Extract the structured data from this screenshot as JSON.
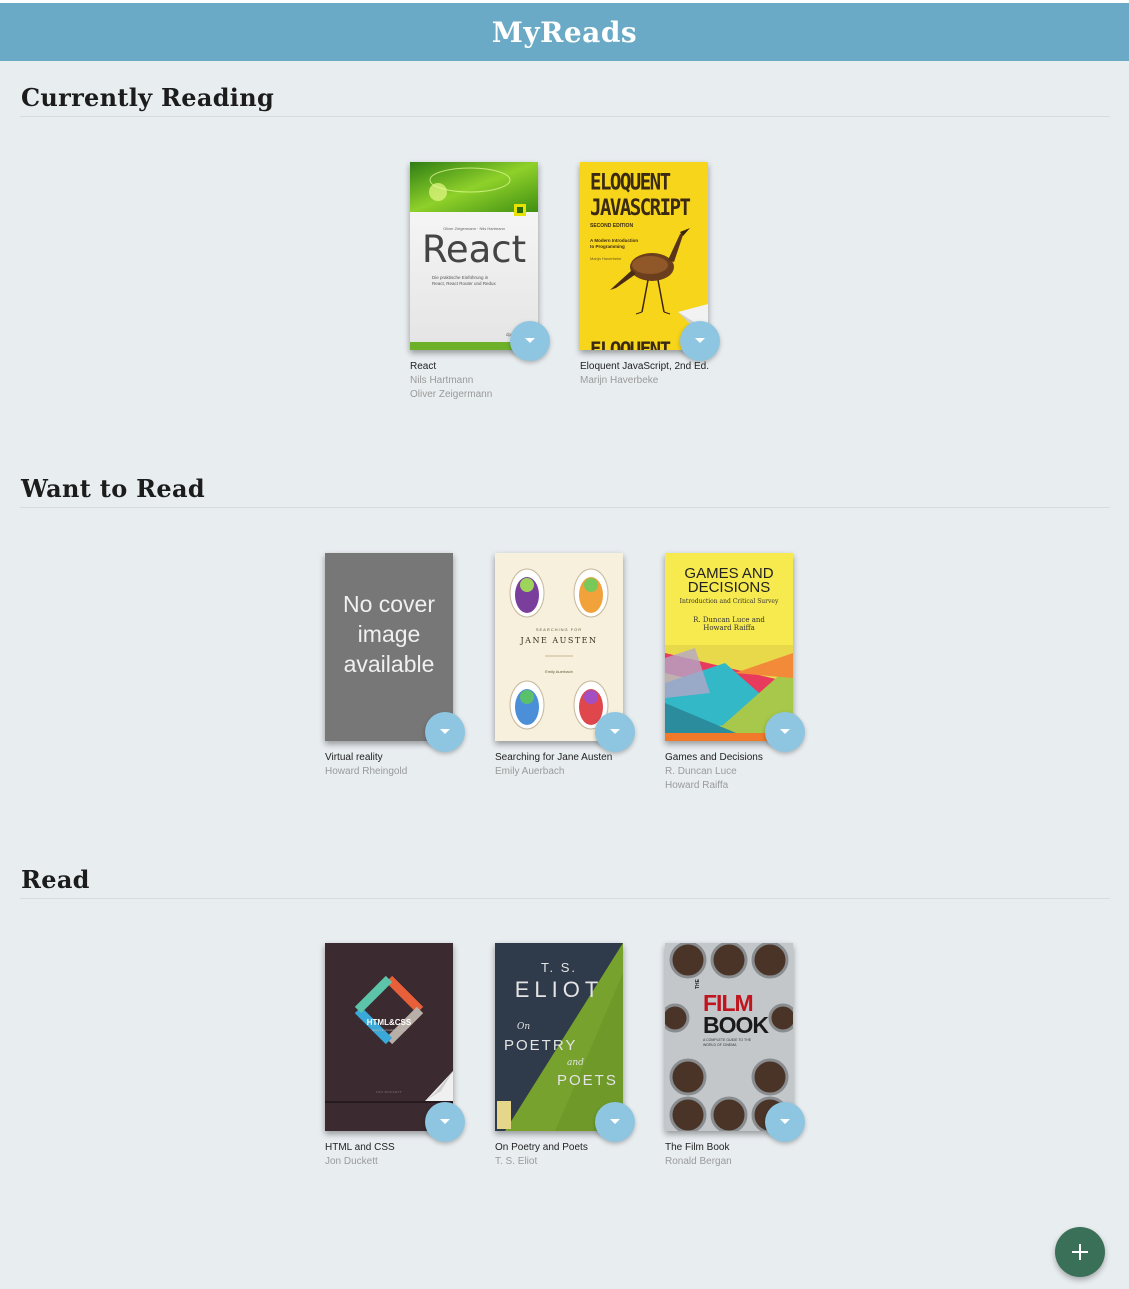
{
  "app": {
    "title": "MyReads"
  },
  "shelves": [
    {
      "title": "Currently Reading",
      "books": [
        {
          "title": "React",
          "authors": [
            "Nils Hartmann",
            "Oliver Zeigermann"
          ],
          "cover": {
            "authors_line": "Oliver Zeigermann · Nils Hartmann",
            "big": "React",
            "sub1": "Die praktische Einführung in",
            "sub2": "React, React Router und Redux",
            "badge": "dpunkt"
          }
        },
        {
          "title": "Eloquent JavaScript, 2nd Ed.",
          "authors": [
            "Marijn Haverbeke"
          ],
          "cover": {
            "line1": "ELOQUENT",
            "line2": "JAVASCRIPT",
            "edition": "SECOND EDITION",
            "sub1": "A Modern Introduction",
            "sub2": "to Programming",
            "author": "Marijn Haverbeke",
            "bottom": "ELOQUENT"
          }
        }
      ]
    },
    {
      "title": "Want to Read",
      "books": [
        {
          "title": "Virtual reality",
          "authors": [
            "Howard Rheingold"
          ],
          "cover": {
            "line1": "No cover",
            "line2": "image",
            "line3": "available"
          }
        },
        {
          "title": "Searching for Jane Austen",
          "authors": [
            "Emily Auerbach"
          ],
          "cover": {
            "small": "SEARCHING FOR",
            "name": "JANE AUSTEN",
            "author": "Emily Auerbach"
          }
        },
        {
          "title": "Games and Decisions",
          "authors": [
            "R. Duncan Luce",
            "Howard Raiffa"
          ],
          "cover": {
            "line1": "GAMES AND",
            "line2": "DECISIONS",
            "sub": "Introduction and Critical Survey",
            "auth1": "R. Duncan Luce and",
            "auth2": "Howard Raiffa"
          }
        }
      ]
    },
    {
      "title": "Read",
      "books": [
        {
          "title": "HTML and CSS",
          "authors": [
            "Jon Duckett"
          ],
          "cover": {
            "logo": "HTML&CSS",
            "sub": "design and build websites",
            "author": "JON DUCKETT"
          }
        },
        {
          "title": "On Poetry and Poets",
          "authors": [
            "T. S. Eliot"
          ],
          "cover": {
            "ts": "T. S.",
            "eliot": "ELIOT",
            "on": "On",
            "poetry": "POETRY",
            "and": "and",
            "poets": "POETS"
          }
        },
        {
          "title": "The Film Book",
          "authors": [
            "Ronald Bergan"
          ],
          "cover": {
            "the": "THE",
            "film": "FILM",
            "book": "BOOK",
            "sub1": "A COMPLETE GUIDE TO THE",
            "sub2": "WORLD OF CINEMA"
          }
        }
      ]
    }
  ],
  "colors": {
    "header": "#6aaac6",
    "background": "#e8edf0",
    "changer": "#8ec6e2",
    "fab": "#3b7058"
  },
  "icons": {
    "changer": "triangle-down-icon",
    "fab": "plus-icon"
  }
}
